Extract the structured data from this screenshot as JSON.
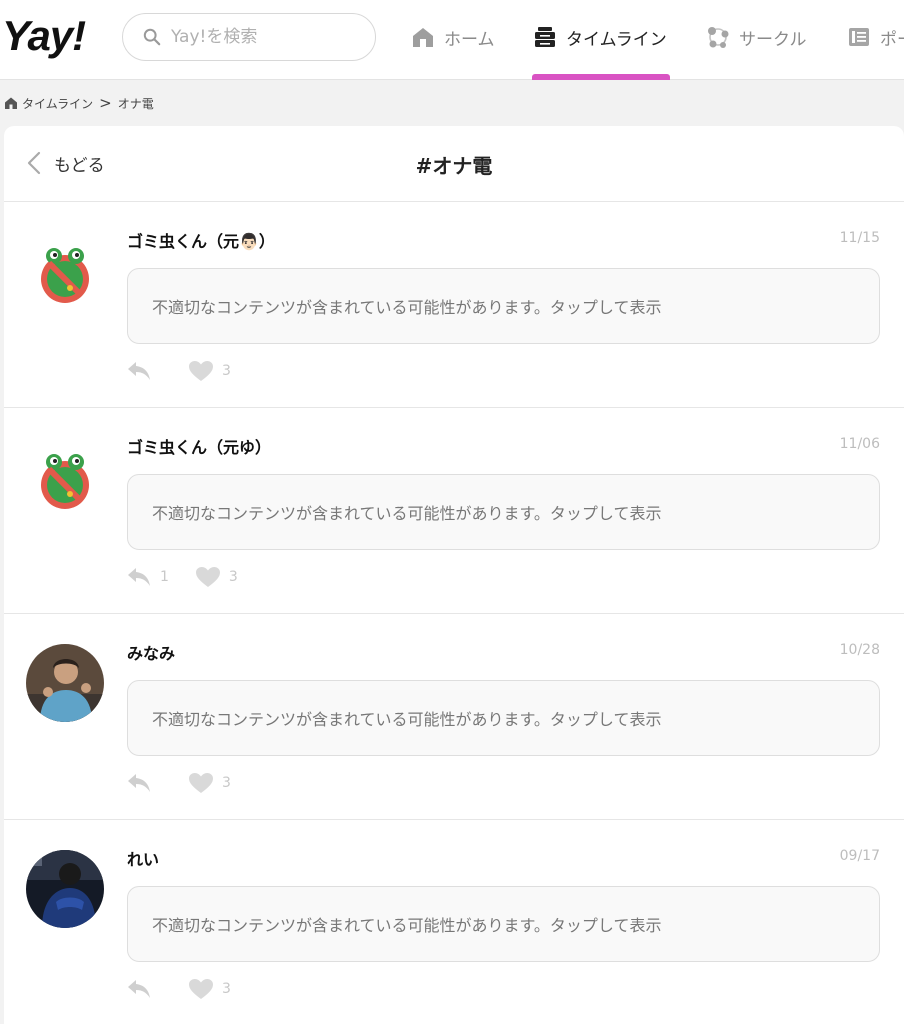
{
  "app": {
    "logo": "Yay!"
  },
  "search": {
    "placeholder": "Yay!を検索"
  },
  "nav": {
    "home": "ホーム",
    "timeline": "タイムライン",
    "circle": "サークル",
    "post": "ポー",
    "accent": "#d953c3"
  },
  "breadcrumb": {
    "home": "タイムライン",
    "separator": ">",
    "current": "オナ電"
  },
  "page": {
    "back_label": "もどる",
    "title": "#オナ電"
  },
  "posts": [
    {
      "username": "ゴミ虫くん（元👨🏻）",
      "date": "11/15",
      "warning": "不適切なコンテンツが含まれている可能性があります。タップして表示",
      "replies": "",
      "likes": "3",
      "avatar": "frog-banned-icon"
    },
    {
      "username": "ゴミ虫くん（元ゆ）",
      "date": "11/06",
      "warning": "不適切なコンテンツが含まれている可能性があります。タップして表示",
      "replies": "1",
      "likes": "3",
      "avatar": "frog-banned-icon"
    },
    {
      "username": "みなみ",
      "date": "10/28",
      "warning": "不適切なコンテンツが含まれている可能性があります。タップして表示",
      "replies": "",
      "likes": "3",
      "avatar": "photo-avatar"
    },
    {
      "username": "れい",
      "date": "09/17",
      "warning": "不適切なコンテンツが含まれている可能性があります。タップして表示",
      "replies": "",
      "likes": "3",
      "avatar": "photo-avatar"
    }
  ]
}
